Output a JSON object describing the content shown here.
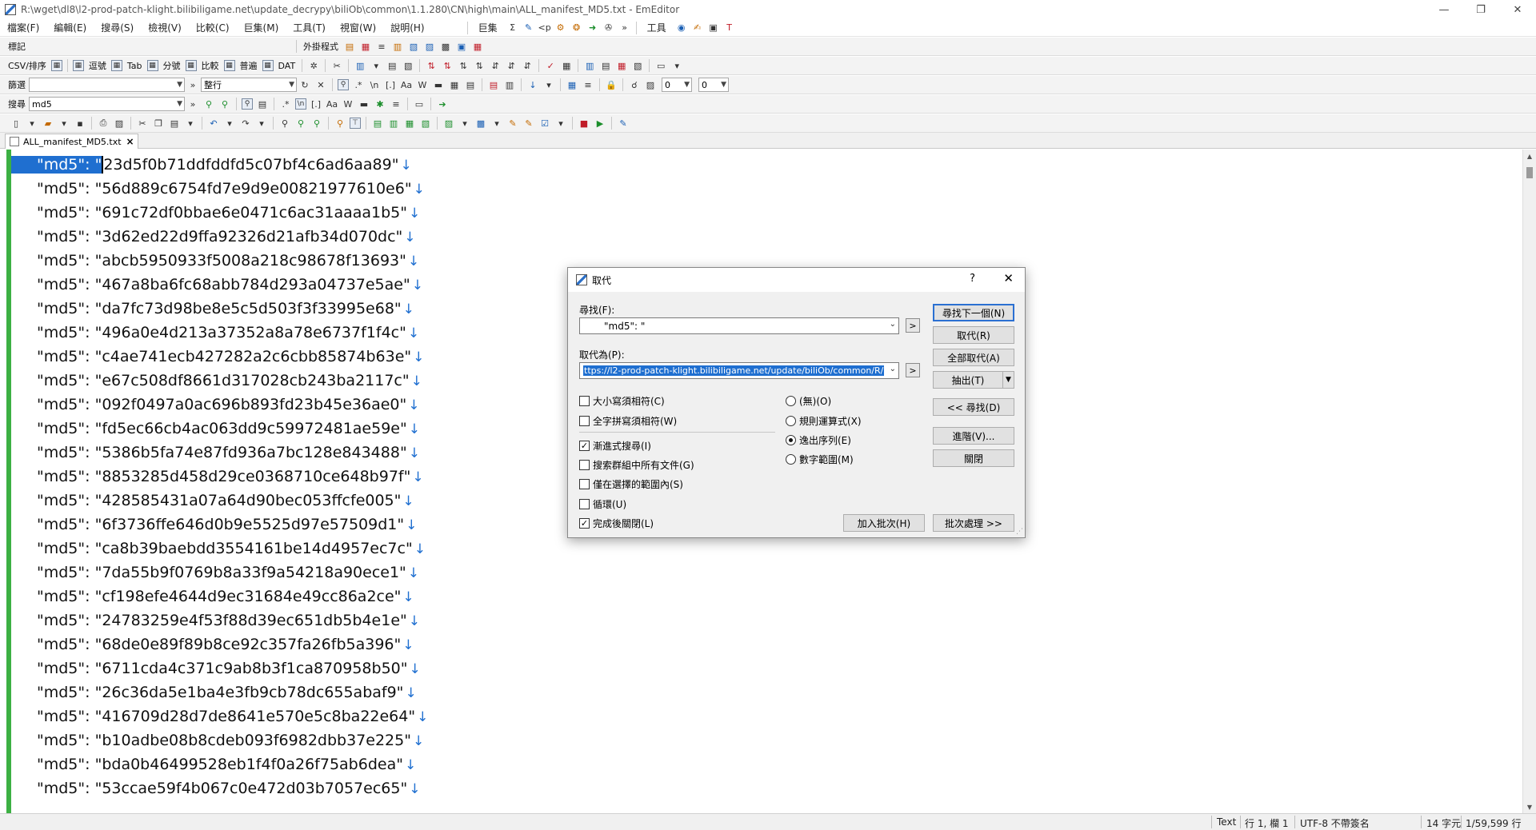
{
  "window": {
    "title": "R:\\wget\\dl8\\l2-prod-patch-klight.bilibiligame.net\\update_decrypy\\biliOb\\common\\1.1.280\\CN\\high\\main\\ALL_manifest_MD5.txt - EmEditor",
    "minimize": "—",
    "restore": "❐",
    "close": "✕"
  },
  "menu": {
    "items": [
      "檔案(F)",
      "編輯(E)",
      "搜尋(S)",
      "檢視(V)",
      "比較(C)",
      "巨集(M)",
      "工具(T)",
      "視窗(W)",
      "說明(H)"
    ],
    "right_items": [
      "巨集",
      "工具"
    ]
  },
  "toolbars": {
    "markers_label": "標記",
    "external_label": "外掛程式",
    "csv_label": "CSV/排序",
    "csv_items": [
      "逗號",
      "Tab",
      "分號",
      "比較",
      "普遍",
      "DAT"
    ],
    "filter_label": "篩選",
    "filter_mode": "整行",
    "filter_num1": "0",
    "filter_num2": "0",
    "search_label": "搜尋",
    "search_value": "md5"
  },
  "tab": {
    "label": "ALL_manifest_MD5.txt",
    "close": "×"
  },
  "editor": {
    "lines": [
      [
        "\"md5\": \"",
        "23d5f0b71ddfddfd5c07bf4c6ad6aa89\""
      ],
      [
        "\"md5\": \"",
        "56d889c6754fd7e9d9e00821977610e6\""
      ],
      [
        "\"md5\": \"",
        "691c72df0bbae6e0471c6ac31aaaa1b5\""
      ],
      [
        "\"md5\": \"",
        "3d62ed22d9ffa92326d21afb34d070dc\""
      ],
      [
        "\"md5\": \"",
        "abcb5950933f5008a218c98678f13693\""
      ],
      [
        "\"md5\": \"",
        "467a8ba6fc68abb784d293a04737e5ae\""
      ],
      [
        "\"md5\": \"",
        "da7fc73d98be8e5c5d503f3f33995e68\""
      ],
      [
        "\"md5\": \"",
        "496a0e4d213a37352a8a78e6737f1f4c\""
      ],
      [
        "\"md5\": \"",
        "c4ae741ecb427282a2c6cbb85874b63e\""
      ],
      [
        "\"md5\": \"",
        "e67c508df8661d317028cb243ba2117c\""
      ],
      [
        "\"md5\": \"",
        "092f0497a0ac696b893fd23b45e36ae0\""
      ],
      [
        "\"md5\": \"",
        "fd5ec66cb4ac063dd9c59972481ae59e\""
      ],
      [
        "\"md5\": \"",
        "5386b5fa74e87fd936a7bc128e843488\""
      ],
      [
        "\"md5\": \"",
        "8853285d458d29ce0368710ce648b97f\""
      ],
      [
        "\"md5\": \"",
        "428585431a07a64d90bec053ffcfe005\""
      ],
      [
        "\"md5\": \"",
        "6f3736ffe646d0b9e5525d97e57509d1\""
      ],
      [
        "\"md5\": \"",
        "ca8b39baebdd3554161be14d4957ec7c\""
      ],
      [
        "\"md5\": \"",
        "7da55b9f0769b8a33f9a54218a90ece1\""
      ],
      [
        "\"md5\": \"",
        "cf198efe4644d9ec31684e49cc86a2ce\""
      ],
      [
        "\"md5\": \"",
        "24783259e4f53f88d39ec651db5b4e1e\""
      ],
      [
        "\"md5\": \"",
        "68de0e89f89b8ce92c357fa26fb5a396\""
      ],
      [
        "\"md5\": \"",
        "6711cda4c371c9ab8b3f1ca870958b50\""
      ],
      [
        "\"md5\": \"",
        "26c36da5e1ba4e3fb9cb78dc655abaf9\""
      ],
      [
        "\"md5\": \"",
        "416709d28d7de8641e570e5c8ba22e64\""
      ],
      [
        "\"md5\": \"",
        "b10adbe08b8cdeb093f6982dbb37e225\""
      ],
      [
        "\"md5\": \"",
        "bda0b46499528eb1f4f0a26f75ab6dea\""
      ],
      [
        "\"md5\": \"",
        "53ccae59f4b067c0e472d03b7057ec65\""
      ]
    ],
    "line_end_mark": "↓"
  },
  "dialog": {
    "title": "取代",
    "help": "?",
    "close": "✕",
    "find_label": "尋找(F):",
    "find_value": "\"md5\": \"",
    "replace_label": "取代為(P):",
    "replace_value": "ttps://l2-prod-patch-klight.bilibiligame.net/update/biliOb/common/R/",
    "arrow_btn": ">",
    "buttons": {
      "find_next": "尋找下一個(N)",
      "replace": "取代(R)",
      "replace_all": "全部取代(A)",
      "extract": "抽出(T)",
      "find": "<< 尋找(D)",
      "advanced": "進階(V)...",
      "close": "關閉",
      "add_batch": "加入批次(H)",
      "batch": "批次處理 >>"
    },
    "checkboxes": [
      {
        "label": "大小寫須相符(C)",
        "checked": false
      },
      {
        "label": "全字拼寫須相符(W)",
        "checked": false
      },
      {
        "label": "漸進式搜尋(I)",
        "checked": true
      },
      {
        "label": "搜索群組中所有文件(G)",
        "checked": false
      },
      {
        "label": "僅在選擇的範圍內(S)",
        "checked": false
      },
      {
        "label": "循環(U)",
        "checked": false
      },
      {
        "label": "完成後關閉(L)",
        "checked": true
      }
    ],
    "radios": [
      {
        "label": "(無)(O)",
        "checked": false
      },
      {
        "label": "規則運算式(X)",
        "checked": false
      },
      {
        "label": "逸出序列(E)",
        "checked": true
      },
      {
        "label": "數字範圍(M)",
        "checked": false
      }
    ]
  },
  "status": {
    "mode": "Text",
    "position": "行 1, 欄 1",
    "encoding": "UTF-8 不帶簽名",
    "chars": "14 字元",
    "lines": "1/59,599 行"
  }
}
